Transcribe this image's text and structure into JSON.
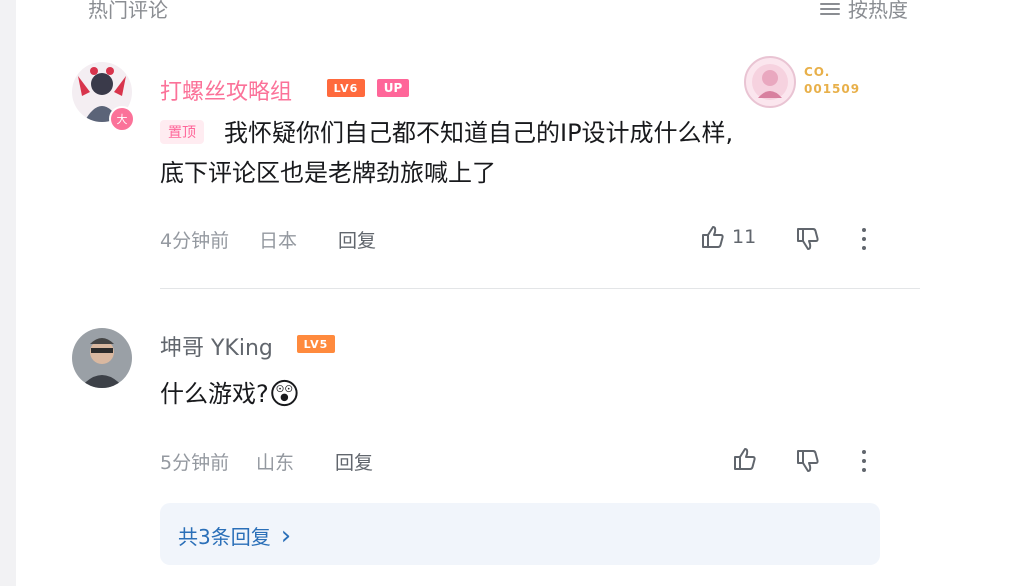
{
  "header": {
    "title": "热门评论",
    "sort_label": "按热度"
  },
  "comments": [
    {
      "username": "打螺丝攻略组",
      "level": "LV6",
      "up_badge": "UP",
      "pinned_label": "置顶",
      "content_line1": "我怀疑你们自己都不知道自己的IP设计成什么样,",
      "content_line2": "底下评论区也是老牌劲旅喊上了",
      "time": "4分钟前",
      "location": "日本",
      "reply_label": "回复",
      "like_count": "11",
      "fan_badge_line1": "CO.",
      "fan_badge_line2": "001509",
      "avatar_badge": "大",
      "username_color": "#fb7299"
    },
    {
      "username": "坤哥 YKing",
      "level": "LV5",
      "content": "什么游戏?",
      "emoji": "😲",
      "time": "5分钟前",
      "location": "山东",
      "reply_label": "回复",
      "username_color": "#61666d"
    }
  ],
  "replies_link": {
    "label": "共3条回复",
    "arrow": "›"
  },
  "colors": {
    "accent_pink": "#fb7299",
    "link_blue": "#2a6fb8"
  },
  "icons": [
    "sort-icon",
    "like-icon",
    "dislike-icon",
    "more-icon",
    "chevron-right-icon"
  ]
}
